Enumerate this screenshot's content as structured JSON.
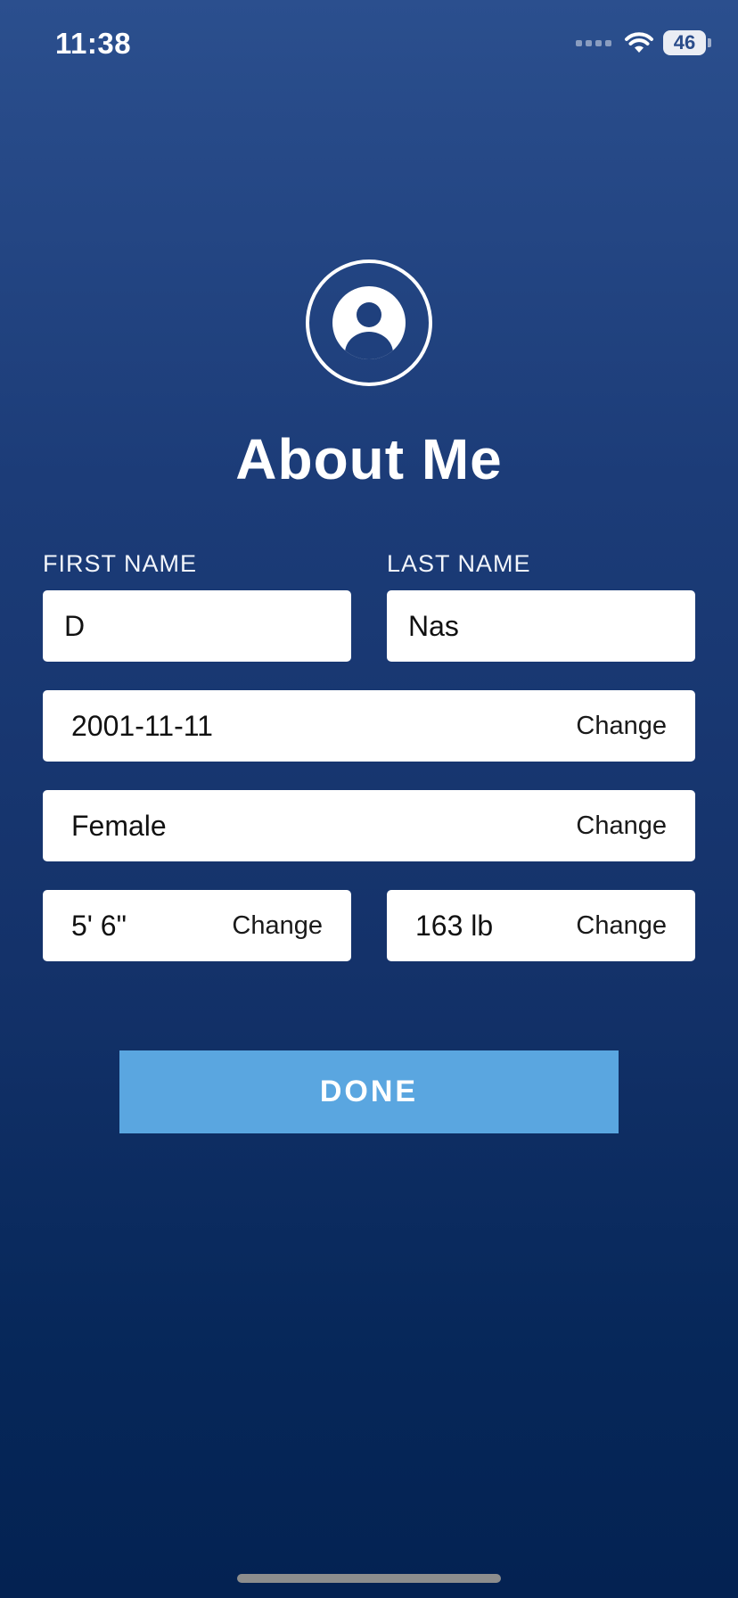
{
  "status_bar": {
    "time": "11:38",
    "battery": "46",
    "icons": [
      "signal-dots-icon",
      "wifi-icon",
      "battery-icon"
    ]
  },
  "header": {
    "avatar_icon": "user-circle-icon",
    "title": "About Me"
  },
  "form": {
    "first_name_label": "FIRST NAME",
    "last_name_label": "LAST NAME",
    "first_name_value": "D",
    "last_name_value": "Nas",
    "birthdate_value": "2001-11-11",
    "gender_value": "Female",
    "height_value": "5' 6\"",
    "weight_value": "163 lb",
    "change_label": "Change"
  },
  "actions": {
    "done_label": "DONE"
  },
  "colors": {
    "background_top": "#2b4f8e",
    "background_bottom": "#042252",
    "button": "#5aa6e0",
    "field": "#ffffff"
  }
}
